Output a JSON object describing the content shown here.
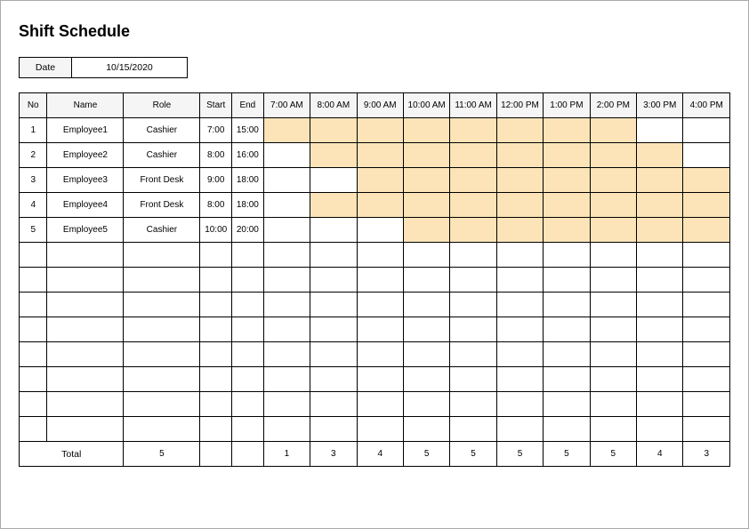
{
  "title": "Shift Schedule",
  "date_label": "Date",
  "date_value": "10/15/2020",
  "headers": {
    "no": "No",
    "name": "Name",
    "role": "Role",
    "start": "Start",
    "end": "End",
    "hours": [
      "7:00 AM",
      "8:00 AM",
      "9:00 AM",
      "10:00 AM",
      "11:00 AM",
      "12:00 PM",
      "1:00 PM",
      "2:00 PM",
      "3:00 PM",
      "4:00 PM"
    ]
  },
  "rows": [
    {
      "no": "1",
      "name": "Employee1",
      "role": "Cashier",
      "start": "7:00",
      "end": "15:00",
      "fill": [
        1,
        1,
        1,
        1,
        1,
        1,
        1,
        1,
        0,
        0
      ]
    },
    {
      "no": "2",
      "name": "Employee2",
      "role": "Cashier",
      "start": "8:00",
      "end": "16:00",
      "fill": [
        0,
        1,
        1,
        1,
        1,
        1,
        1,
        1,
        1,
        0
      ]
    },
    {
      "no": "3",
      "name": "Employee3",
      "role": "Front Desk",
      "start": "9:00",
      "end": "18:00",
      "fill": [
        0,
        0,
        1,
        1,
        1,
        1,
        1,
        1,
        1,
        1
      ]
    },
    {
      "no": "4",
      "name": "Employee4",
      "role": "Front Desk",
      "start": "8:00",
      "end": "18:00",
      "fill": [
        0,
        1,
        1,
        1,
        1,
        1,
        1,
        1,
        1,
        1
      ]
    },
    {
      "no": "5",
      "name": "Employee5",
      "role": "Cashier",
      "start": "10:00",
      "end": "20:00",
      "fill": [
        0,
        0,
        0,
        1,
        1,
        1,
        1,
        1,
        1,
        1
      ]
    }
  ],
  "empty_rows": 8,
  "total_label": "Total",
  "total_role": "5",
  "totals": [
    "1",
    "3",
    "4",
    "5",
    "5",
    "5",
    "5",
    "5",
    "4",
    "3"
  ]
}
